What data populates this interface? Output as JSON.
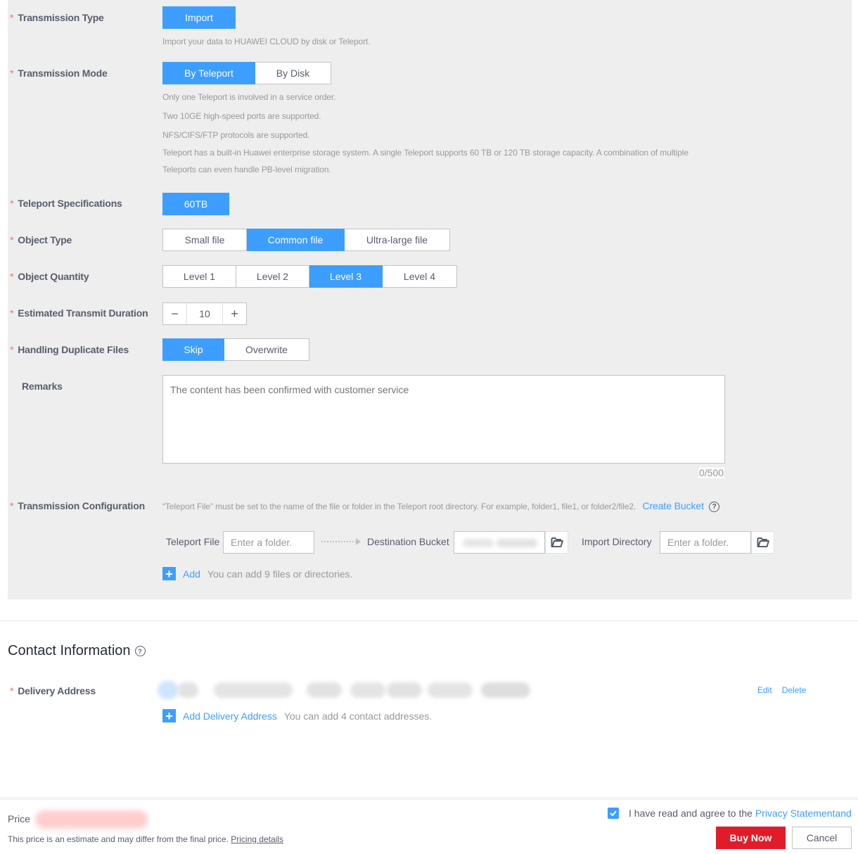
{
  "form": {
    "transmission_type": {
      "label": "Transmission Type",
      "options": [
        "Import"
      ],
      "selected": "Import",
      "help": "Import your data to HUAWEI CLOUD by disk or Teleport."
    },
    "transmission_mode": {
      "label": "Transmission Mode",
      "options": [
        "By Teleport",
        "By Disk"
      ],
      "selected": "By Teleport",
      "help": [
        "Only one Teleport is involved in a service order.",
        "Two 10GE high-speed ports are supported.",
        "NFS/CIFS/FTP protocols are supported.",
        "Teleport has a built-in Huawei enterprise storage system. A single Teleport supports 60 TB or 120 TB storage capacity. A combination of multiple",
        "Teleports can even handle PB-level migration."
      ]
    },
    "teleport_specifications": {
      "label": "Teleport Specifications",
      "options": [
        "60TB"
      ],
      "selected": "60TB"
    },
    "object_type": {
      "label": "Object Type",
      "options": [
        "Small file",
        "Common file",
        "Ultra-large file"
      ],
      "selected": "Common file"
    },
    "object_quantity": {
      "label": "Object Quantity",
      "options": [
        "Level 1",
        "Level 2",
        "Level 3",
        "Level 4"
      ],
      "selected": "Level 3"
    },
    "estimated_transmit_duration": {
      "label": "Estimated Transmit Duration",
      "value": "10",
      "minus": "−",
      "plus": "+"
    },
    "handling_duplicate_files": {
      "label": "Handling Duplicate Files",
      "options": [
        "Skip",
        "Overwrite"
      ],
      "selected": "Skip"
    },
    "remarks": {
      "label": "Remarks",
      "placeholder": "The content has been confirmed with customer service",
      "counter": "0/500"
    },
    "transmission_configuration": {
      "label": "Transmission Configuration",
      "help": "“Teleport File” must be set to the name of the file or folder in the Teleport root directory. For example, folder1, file1, or folder2/file2.",
      "create_bucket_link": "Create Bucket",
      "teleport_file_label": "Teleport File",
      "teleport_file_placeholder": "Enter a folder.",
      "destination_bucket_label": "Destination Bucket",
      "import_directory_label": "Import Directory",
      "import_directory_placeholder": "Enter a folder.",
      "add_label": "Add",
      "add_hint": "You can add 9 files or directories."
    }
  },
  "contact": {
    "title": "Contact Information",
    "delivery_address_label": "Delivery Address",
    "edit_label": "Edit",
    "delete_label": "Delete",
    "add_label": "Add Delivery Address",
    "add_hint": "You can add 4 contact addresses."
  },
  "footer": {
    "price_label": "Price",
    "price_note": "This price is an estimate and may differ from the final price.",
    "pricing_details_link": "Pricing details",
    "agree_text": "I have read and agree to the",
    "privacy_link": "Privacy Statementand",
    "agree_checked": true,
    "buy_now_label": "Buy Now",
    "cancel_label": "Cancel"
  },
  "colors": {
    "accent": "#3d9eff",
    "buy": "#e11c2a",
    "required": "#f66f6a",
    "panel": "#eeeeee"
  }
}
